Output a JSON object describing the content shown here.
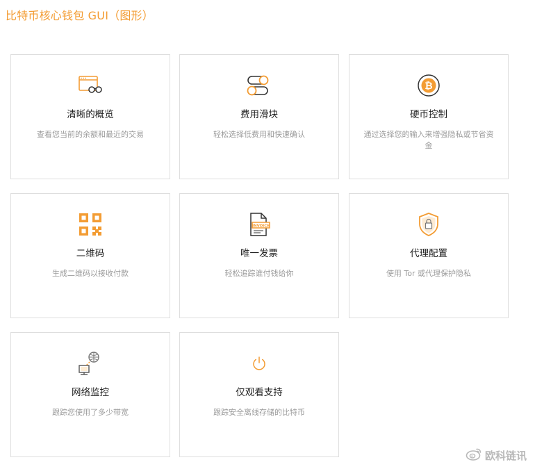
{
  "page": {
    "title": "比特币核心钱包 GUI（图形）"
  },
  "colors": {
    "accent": "#f39c33",
    "title_text": "#222222",
    "desc_text": "#9a9a9a",
    "card_border": "#dedede"
  },
  "cards": [
    {
      "icon": "browser-glasses-icon",
      "title": "清晰的概览",
      "desc": "查看您当前的余额和最近的交易"
    },
    {
      "icon": "toggle-slider-icon",
      "title": "费用滑块",
      "desc": "轻松选择低费用和快速确认"
    },
    {
      "icon": "bitcoin-icon",
      "title": "硬币控制",
      "desc": "通过选择您的输入来增强隐私或节省资金"
    },
    {
      "icon": "qr-code-icon",
      "title": "二维码",
      "desc": "生成二维码以接收付款"
    },
    {
      "icon": "invoice-icon",
      "title": "唯一发票",
      "desc": "轻松追踪谁付钱给你"
    },
    {
      "icon": "shield-lock-icon",
      "title": "代理配置",
      "desc": "使用 Tor 或代理保护隐私"
    },
    {
      "icon": "network-monitor-icon",
      "title": "网络监控",
      "desc": "跟踪您使用了多少带宽"
    },
    {
      "icon": "power-icon",
      "title": "仅观看支持",
      "desc": "跟踪安全离线存储的比特币"
    }
  ],
  "watermark": {
    "text": "欧科链讯",
    "icon": "weibo-icon"
  }
}
